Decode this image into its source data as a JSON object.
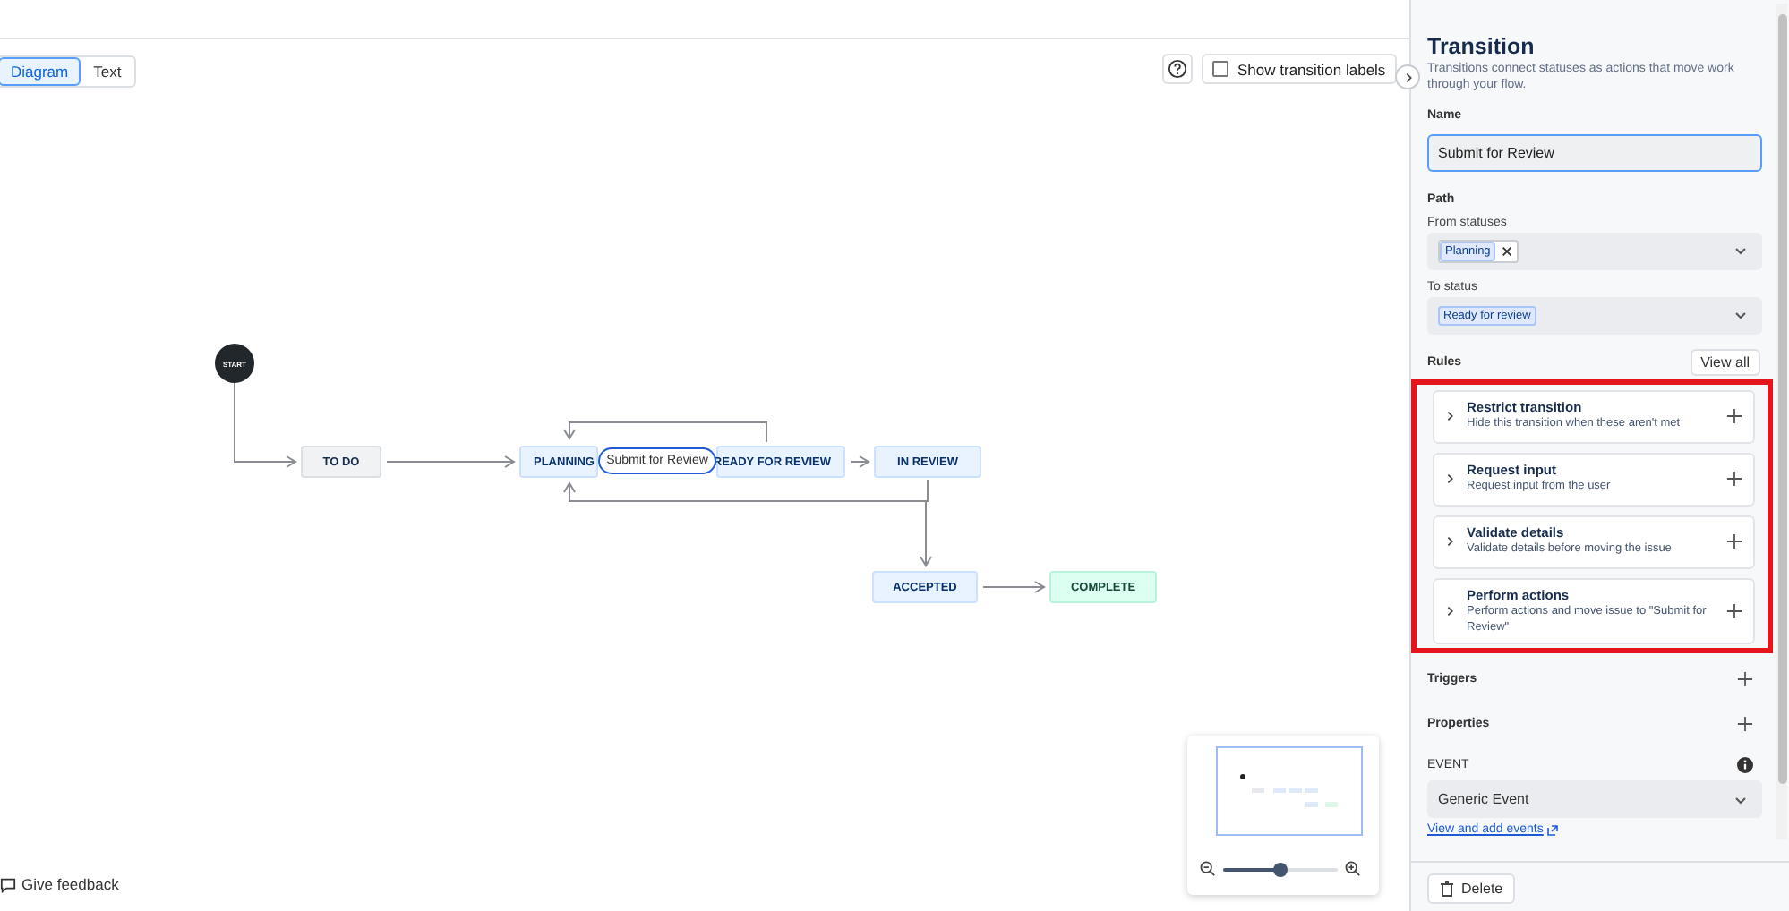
{
  "view_toggle": [
    {
      "label": "Diagram",
      "selected": true
    },
    {
      "label": "Text",
      "selected": false
    }
  ],
  "show_transition_labels": {
    "label": "Show transition labels",
    "checked": false
  },
  "diagram": {
    "start_label": "START",
    "transition_label": "Submit for Review",
    "statuses": [
      {
        "label": "TO DO",
        "kind": "todo"
      },
      {
        "label": "PLANNING",
        "kind": "progress"
      },
      {
        "label": "READY FOR REVIEW",
        "kind": "progress"
      },
      {
        "label": "IN REVIEW",
        "kind": "progress"
      },
      {
        "label": "ACCEPTED",
        "kind": "progress"
      },
      {
        "label": "COMPLETE",
        "kind": "done"
      }
    ]
  },
  "zoom": {
    "level": 0.5
  },
  "feedback": "Give feedback",
  "panel": {
    "title": "Transition",
    "description": "Transitions connect statuses as actions that move work through your flow.",
    "name_label": "Name",
    "name_value": "Submit for Review",
    "path_label": "Path",
    "from_label": "From statuses",
    "from_tags": [
      "Planning"
    ],
    "to_label": "To status",
    "to_tags": [
      "Ready for review"
    ],
    "rules_label": "Rules",
    "view_all": "View all",
    "rules_highlighted": true,
    "rules": [
      {
        "title": "Restrict transition",
        "description": "Hide this transition when these aren't met"
      },
      {
        "title": "Request input",
        "description": "Request input from the user"
      },
      {
        "title": "Validate details",
        "description": "Validate details before moving the issue"
      },
      {
        "title": "Perform actions",
        "description": "Perform actions and move issue to \"Submit for Review\""
      }
    ],
    "triggers": "Triggers",
    "properties": "Properties",
    "event_label": "EVENT",
    "event_value": "Generic Event",
    "event_link": "View and add events",
    "delete": "Delete"
  }
}
